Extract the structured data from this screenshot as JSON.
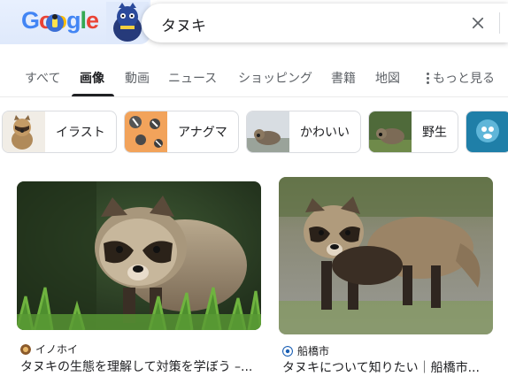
{
  "search": {
    "query": "タヌキ"
  },
  "tabs": [
    {
      "label": "すべて"
    },
    {
      "label": "画像"
    },
    {
      "label": "動画"
    },
    {
      "label": "ニュース"
    },
    {
      "label": "ショッピング"
    },
    {
      "label": "書籍"
    },
    {
      "label": "地図"
    },
    {
      "label": "もっと見る"
    }
  ],
  "chips": [
    {
      "label": "イラスト"
    },
    {
      "label": "アナグマ"
    },
    {
      "label": "かわいい"
    },
    {
      "label": "野生"
    }
  ],
  "results": [
    {
      "source": "イノホイ",
      "title": "タヌキの生態を理解して対策を学ぼう –..."
    },
    {
      "source": "船橋市",
      "title": "タヌキについて知りたい｜船橋市..."
    }
  ],
  "colors": {
    "accent": "#202124",
    "muted": "#5f6368",
    "border": "#dadce0"
  }
}
